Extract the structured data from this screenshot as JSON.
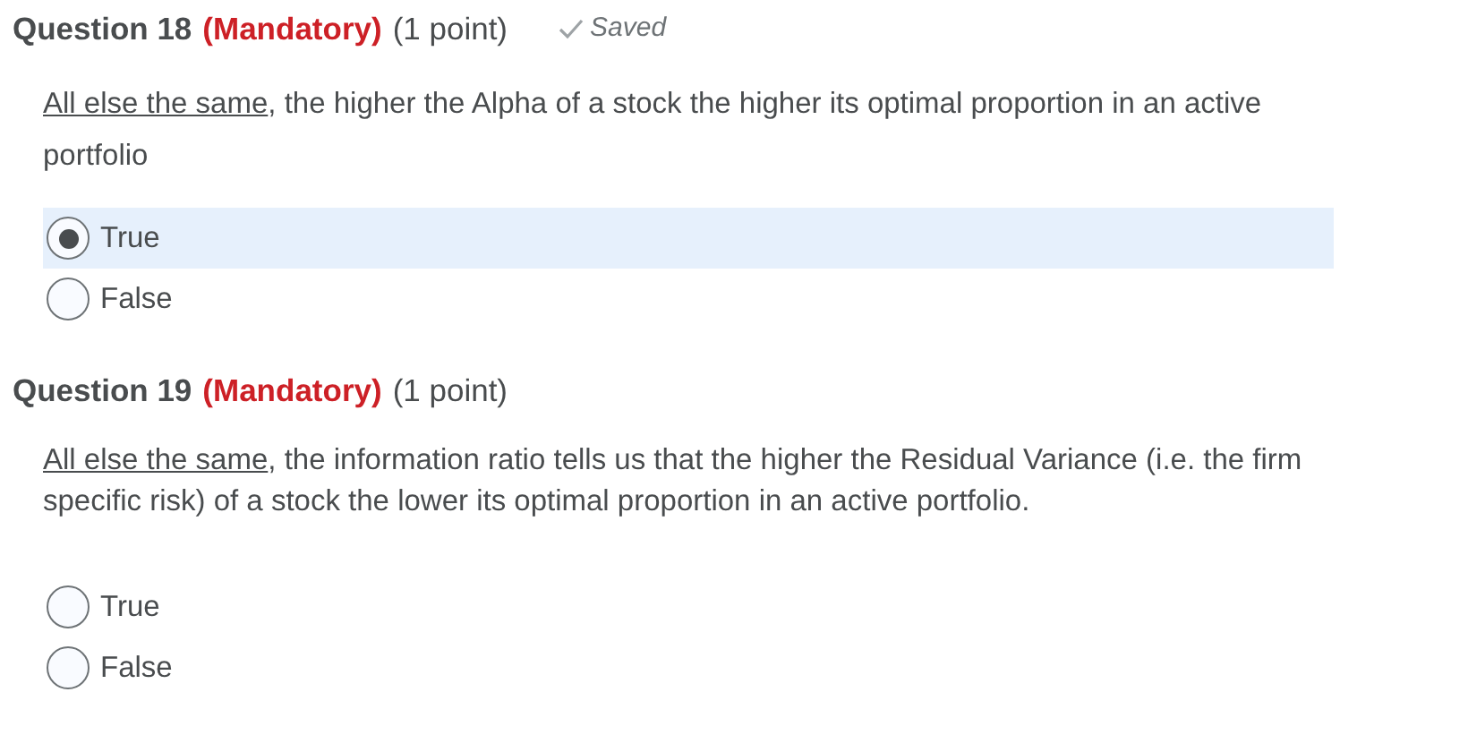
{
  "questions": [
    {
      "title": "Question 18",
      "mandatory": "(Mandatory)",
      "points": "(1 point)",
      "status": "Saved",
      "prompt_lead": "All else the same",
      "prompt_rest": ", the higher the Alpha of a stock the higher its optimal proportion in an active portfolio",
      "options": [
        {
          "label": "True",
          "selected": true
        },
        {
          "label": "False",
          "selected": false
        }
      ]
    },
    {
      "title": "Question 19",
      "mandatory": "(Mandatory)",
      "points": "(1 point)",
      "prompt_lead": "All else the same",
      "prompt_rest": ", the information ratio tells us that the higher the Residual Variance (i.e. the firm specific risk) of a stock the lower its optimal proportion in an active portfolio.",
      "options": [
        {
          "label": "True",
          "selected": false
        },
        {
          "label": "False",
          "selected": false
        }
      ]
    }
  ]
}
